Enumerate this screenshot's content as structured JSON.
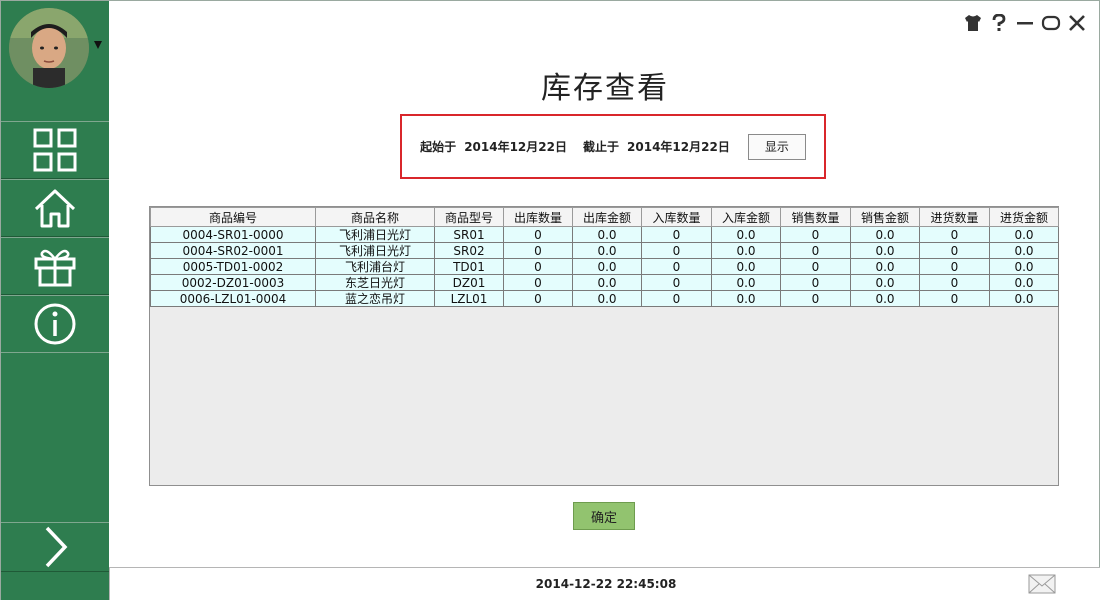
{
  "window": {
    "controls": [
      {
        "name": "skin-icon"
      },
      {
        "name": "help-icon"
      },
      {
        "name": "minimize-icon"
      },
      {
        "name": "maximize-icon"
      },
      {
        "name": "close-icon"
      }
    ]
  },
  "sidebar": {
    "items": [
      {
        "name": "grid-icon"
      },
      {
        "name": "home-icon"
      },
      {
        "name": "gift-icon"
      },
      {
        "name": "info-icon"
      }
    ],
    "expand_icon": "chevron-right-icon"
  },
  "page": {
    "title": "库存查看"
  },
  "filter": {
    "start_label": "起始于",
    "start_date": "2014年12月22日",
    "end_label": "截止于",
    "end_date": "2014年12月22日",
    "show_button": "显示"
  },
  "table": {
    "headers": [
      "商品编号",
      "商品名称",
      "商品型号",
      "出库数量",
      "出库金额",
      "入库数量",
      "入库金额",
      "销售数量",
      "销售金额",
      "进货数量",
      "进货金额"
    ],
    "rows": [
      [
        "0004-SR01-0000",
        "飞利浦日光灯",
        "SR01",
        "0",
        "0.0",
        "0",
        "0.0",
        "0",
        "0.0",
        "0",
        "0.0"
      ],
      [
        "0004-SR02-0001",
        "飞利浦日光灯",
        "SR02",
        "0",
        "0.0",
        "0",
        "0.0",
        "0",
        "0.0",
        "0",
        "0.0"
      ],
      [
        "0005-TD01-0002",
        "飞利浦台灯",
        "TD01",
        "0",
        "0.0",
        "0",
        "0.0",
        "0",
        "0.0",
        "0",
        "0.0"
      ],
      [
        "0002-DZ01-0003",
        "东芝日光灯",
        "DZ01",
        "0",
        "0.0",
        "0",
        "0.0",
        "0",
        "0.0",
        "0",
        "0.0"
      ],
      [
        "0006-LZL01-0004",
        "蓝之恋吊灯",
        "LZL01",
        "0",
        "0.0",
        "0",
        "0.0",
        "0",
        "0.0",
        "0",
        "0.0"
      ]
    ]
  },
  "confirm_button": "确定",
  "status": {
    "datetime": "2014-12-22 22:45:08"
  },
  "colors": {
    "sidebar": "#2e7d4f",
    "highlight_border": "#d9262b",
    "row_bg": "#e4fdfd",
    "confirm_bg": "#92c36f"
  }
}
